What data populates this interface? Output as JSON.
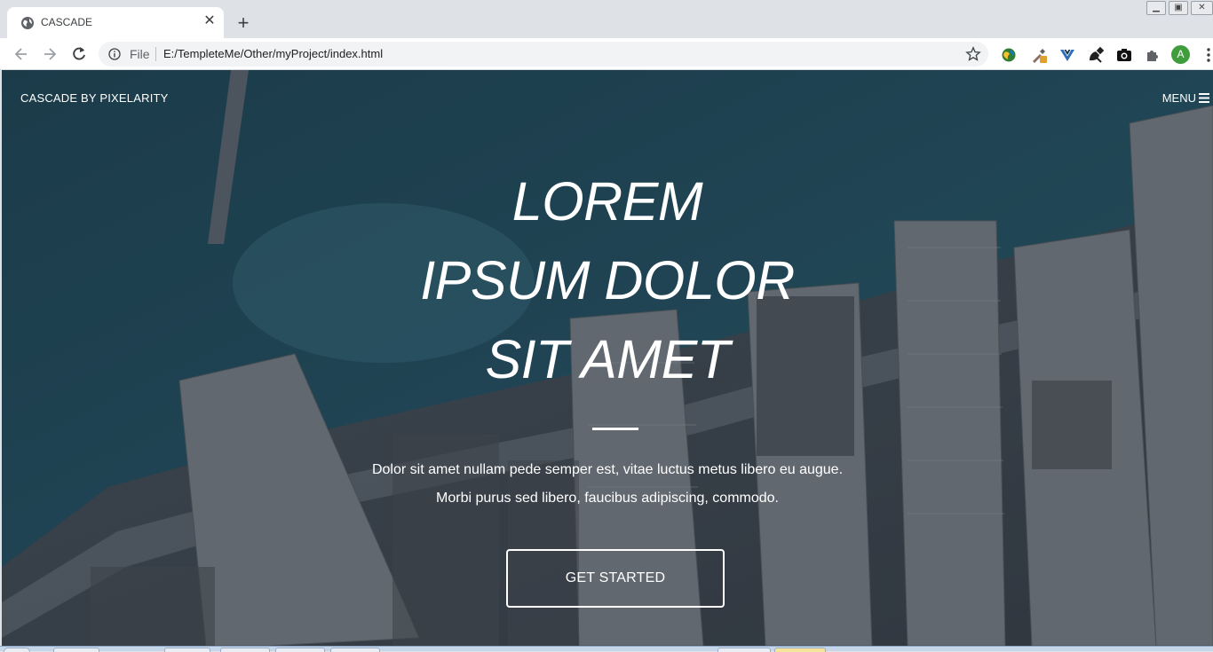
{
  "browser": {
    "tab_title": "CASCADE",
    "tab_close_glyph": "✕",
    "new_tab_glyph": "+",
    "url_scheme": "File",
    "url": "E:/TempleteMe/Other/myProject/index.html",
    "profile_initial": "A",
    "window_controls": [
      "minimize",
      "restore",
      "close"
    ],
    "extensions": [
      "globe-extension-icon",
      "eyedropper-extension-icon",
      "vuejs-devtools-icon",
      "satellite-extension-icon",
      "screenshot-camera-icon",
      "extensions-puzzle-icon"
    ]
  },
  "site": {
    "brand": "CASCADE BY PIXELARITY",
    "menu_label": "MENU",
    "headline_lines": [
      "LOREM",
      "IPSUM DOLOR",
      "SIT AMET"
    ],
    "lead_lines": [
      "Dolor sit amet nullam pede semper est, vitae luctus metus libero eu augue.",
      "Morbi purus sed libero, faucibus adipiscing, commodo."
    ],
    "cta_label": "GET STARTED"
  },
  "colors": {
    "tabstrip_bg": "#dee1e6",
    "hero_overlay": "#2b4453",
    "text": "#ffffff",
    "avatar_bg": "#3f9d3b"
  }
}
